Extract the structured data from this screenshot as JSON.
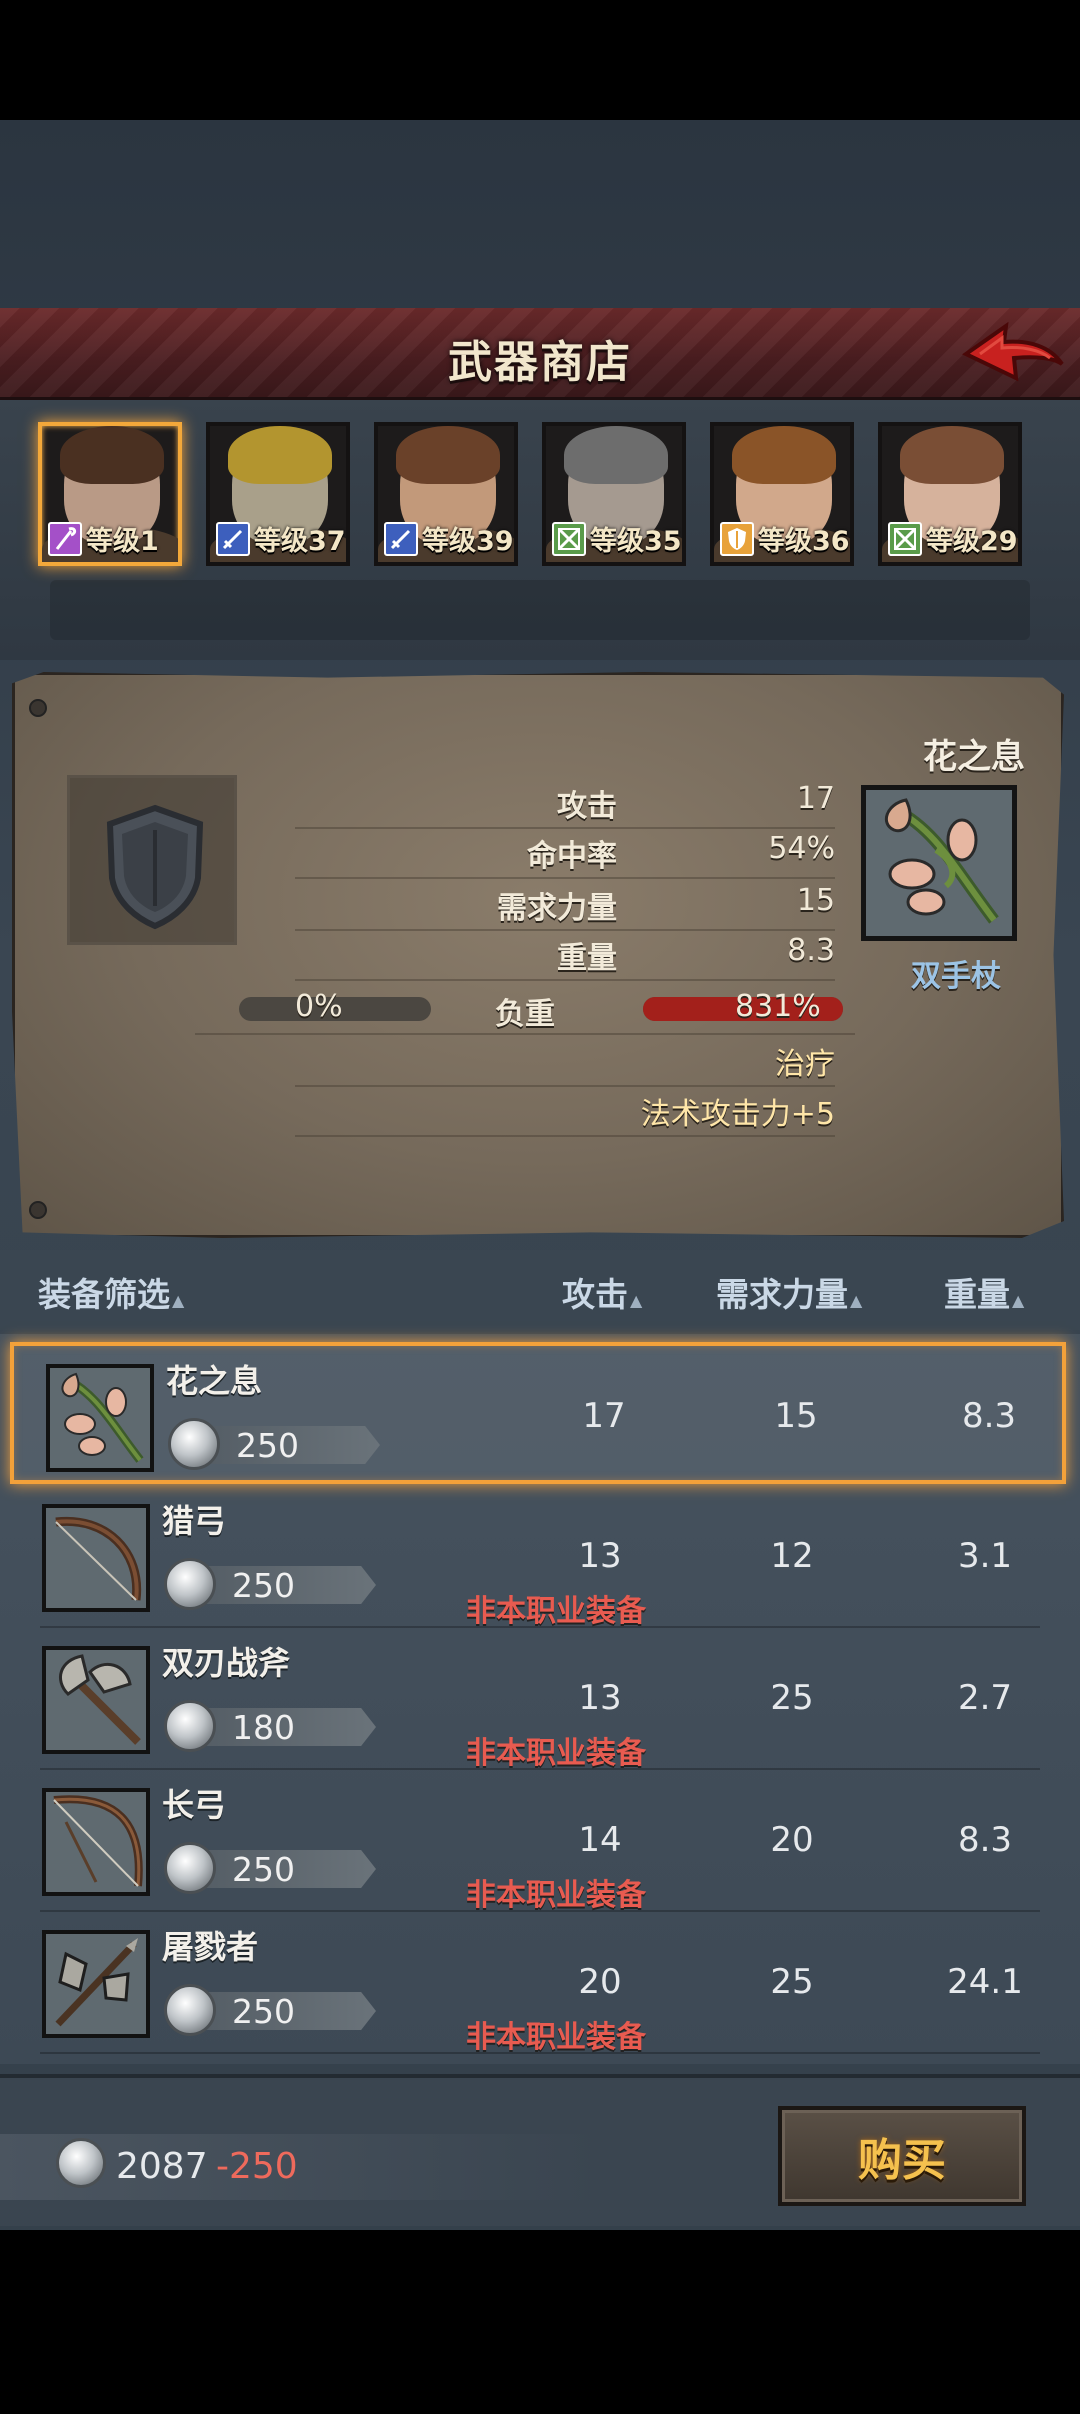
{
  "header": {
    "title": "武器商店",
    "back_icon": "back-arrow-icon"
  },
  "heroes": [
    {
      "level": "等级1",
      "class_icon": "staff-icon",
      "class_color": "#a450c8",
      "hair": "#4a3021",
      "skin": "#b99a86",
      "active": true
    },
    {
      "level": "等级37",
      "class_icon": "sword-icon",
      "class_color": "#3d5fbd",
      "hair": "#b3952f",
      "skin": "#a9a08a",
      "active": false
    },
    {
      "level": "等级39",
      "class_icon": "sword-icon",
      "class_color": "#3d5fbd",
      "hair": "#6a4129",
      "skin": "#c2997a",
      "active": false
    },
    {
      "level": "等级35",
      "class_icon": "bow-icon",
      "class_color": "#5a9b4a",
      "hair": "#6d6d6d",
      "skin": "#a59a90",
      "active": false
    },
    {
      "level": "等级36",
      "class_icon": "shield-icon",
      "class_color": "#e8a23a",
      "hair": "#8a5428",
      "skin": "#d1a88b",
      "active": false
    },
    {
      "level": "等级29",
      "class_icon": "bow-icon",
      "class_color": "#5a9b4a",
      "hair": "#7a4e35",
      "skin": "#d6b29c",
      "active": false
    }
  ],
  "info": {
    "weapon_name": "花之息",
    "weapon_type": "双手杖",
    "stats": [
      {
        "label": "攻击",
        "value": "17"
      },
      {
        "label": "命中率",
        "value": "54%"
      },
      {
        "label": "需求力量",
        "value": "15"
      },
      {
        "label": "重量",
        "value": "8.3"
      }
    ],
    "load": {
      "label": "负重",
      "current": "0%",
      "current_fraction": 0.0,
      "new": "831%",
      "new_fraction": 1.0
    },
    "extras": [
      "治疗",
      "法术攻击力+5"
    ]
  },
  "list_header": {
    "filter": "装备筛选",
    "attack": "攻击",
    "strength": "需求力量",
    "weight": "重量"
  },
  "items": [
    {
      "name": "花之息",
      "price": "250",
      "attack": "17",
      "strength": "15",
      "weight": "8.3",
      "warning": "",
      "selected": true,
      "icon": "flower-staff-icon"
    },
    {
      "name": "猎弓",
      "price": "250",
      "attack": "13",
      "strength": "12",
      "weight": "3.1",
      "warning": "非本职业装备",
      "selected": false,
      "icon": "hunting-bow-icon"
    },
    {
      "name": "双刃战斧",
      "price": "180",
      "attack": "13",
      "strength": "25",
      "weight": "2.7",
      "warning": "非本职业装备",
      "selected": false,
      "icon": "double-axe-icon"
    },
    {
      "name": "长弓",
      "price": "250",
      "attack": "14",
      "strength": "20",
      "weight": "8.3",
      "warning": "非本职业装备",
      "selected": false,
      "icon": "longbow-icon"
    },
    {
      "name": "屠戮者",
      "price": "250",
      "attack": "20",
      "strength": "25",
      "weight": "24.1",
      "warning": "非本职业装备",
      "selected": false,
      "icon": "slayer-axe-icon"
    }
  ],
  "footer": {
    "money": "2087",
    "money_delta": "-250",
    "buy_label": "购买"
  }
}
